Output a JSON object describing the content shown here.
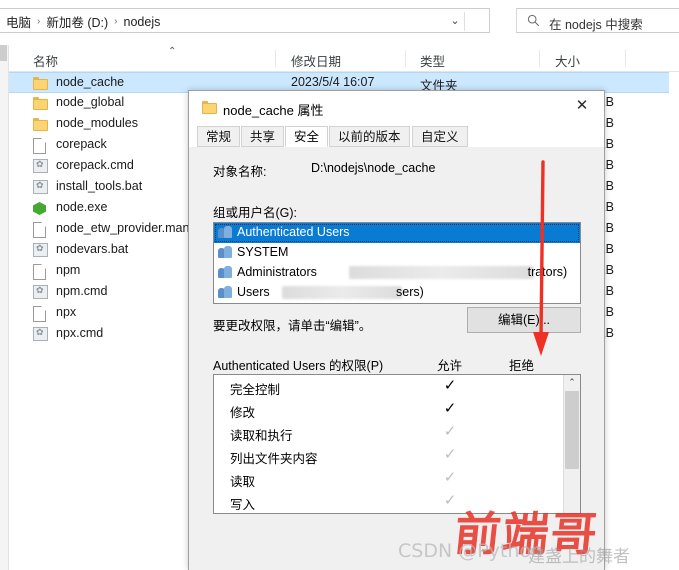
{
  "explorer": {
    "address": {
      "crumbs": [
        "电脑",
        "新加卷 (D:)",
        "nodejs"
      ],
      "separator": "›",
      "chevron": "⌄",
      "refresh_icon": "refresh-icon",
      "refresh_glyph": "↻"
    },
    "search": {
      "icon": "search-icon",
      "text": "在 nodejs 中搜索"
    },
    "columns": [
      {
        "label": "名称",
        "key": "name"
      },
      {
        "label": "修改日期",
        "key": "date"
      },
      {
        "label": "类型",
        "key": "type"
      },
      {
        "label": "大小",
        "key": "size"
      }
    ],
    "sort_caret": "⌃",
    "rows": [
      {
        "name": "node_cache",
        "icon": "folder-icon",
        "date": "2023/5/4 16:07",
        "type": "文件夹",
        "size": "",
        "selected": true
      },
      {
        "name": "node_global",
        "icon": "folder-icon",
        "date": "",
        "type": "",
        "size": "KB",
        "selected": false
      },
      {
        "name": "node_modules",
        "icon": "folder-icon",
        "date": "",
        "type": "",
        "size": "KB",
        "selected": false
      },
      {
        "name": "corepack",
        "icon": "document-icon",
        "date": "",
        "type": "",
        "size": "KB",
        "selected": false
      },
      {
        "name": "corepack.cmd",
        "icon": "script-icon",
        "date": "",
        "type": "",
        "size": "KB",
        "selected": false
      },
      {
        "name": "install_tools.bat",
        "icon": "script-icon",
        "date": "",
        "type": "",
        "size": "KB",
        "selected": false
      },
      {
        "name": "node.exe",
        "icon": "node-icon",
        "date": "",
        "type": "",
        "size": "KB",
        "selected": false
      },
      {
        "name": "node_etw_provider.man",
        "icon": "document-icon",
        "date": "",
        "type": "",
        "size": "KB",
        "selected": false
      },
      {
        "name": "nodevars.bat",
        "icon": "script-icon",
        "date": "",
        "type": "",
        "size": "KB",
        "selected": false
      },
      {
        "name": "npm",
        "icon": "document-icon",
        "date": "",
        "type": "",
        "size": "KB",
        "selected": false
      },
      {
        "name": "npm.cmd",
        "icon": "script-icon",
        "date": "",
        "type": "",
        "size": "KB",
        "selected": false
      },
      {
        "name": "npx",
        "icon": "document-icon",
        "date": "",
        "type": "",
        "size": "KB",
        "selected": false
      },
      {
        "name": "npx.cmd",
        "icon": "script-icon",
        "date": "",
        "type": "",
        "size": "KB",
        "selected": false
      }
    ]
  },
  "dialog": {
    "title": "node_cache 属性",
    "title_icon": "folder-icon",
    "close_label": "✕",
    "tabs": [
      {
        "label": "常规",
        "active": false
      },
      {
        "label": "共享",
        "active": false
      },
      {
        "label": "安全",
        "active": true
      },
      {
        "label": "以前的版本",
        "active": false
      },
      {
        "label": "自定义",
        "active": false
      }
    ],
    "object_name_label": "对象名称:",
    "object_name_value": "D:\\nodejs\\node_cache",
    "group_label": "组或用户名(G):",
    "groups": [
      {
        "name": "Authenticated Users",
        "suffix": "",
        "selected": true,
        "redacted": false
      },
      {
        "name": "SYSTEM",
        "suffix": "",
        "selected": false,
        "redacted": false
      },
      {
        "name": "Administrators",
        "suffix": "trators)",
        "selected": false,
        "redacted": true
      },
      {
        "name": "Users",
        "suffix": "sers)",
        "selected": false,
        "redacted": true
      }
    ],
    "hint_text": "要更改权限，请单击“编辑”。",
    "edit_button": "编辑(E)...",
    "permissions_label": "Authenticated Users 的权限(P)",
    "allow_label": "允许",
    "deny_label": "拒绝",
    "permissions": [
      {
        "name": "完全控制",
        "allow": "✓",
        "allow_state": "on"
      },
      {
        "name": "修改",
        "allow": "✓",
        "allow_state": "on"
      },
      {
        "name": "读取和执行",
        "allow": "✓",
        "allow_state": "dim"
      },
      {
        "name": "列出文件夹内容",
        "allow": "✓",
        "allow_state": "dim"
      },
      {
        "name": "读取",
        "allow": "✓",
        "allow_state": "dim"
      },
      {
        "name": "写入",
        "allow": "✓",
        "allow_state": "dim"
      }
    ],
    "scroll_up_glyph": "⌃"
  },
  "annotation": {
    "arrow_color": "#ee3124",
    "arrow_name": "red-down-arrow"
  },
  "watermark": {
    "logo": "前端哥",
    "text": "CSDN @Python",
    "sub": "建盏上的舞者",
    "logo_color": "#e8342a"
  }
}
